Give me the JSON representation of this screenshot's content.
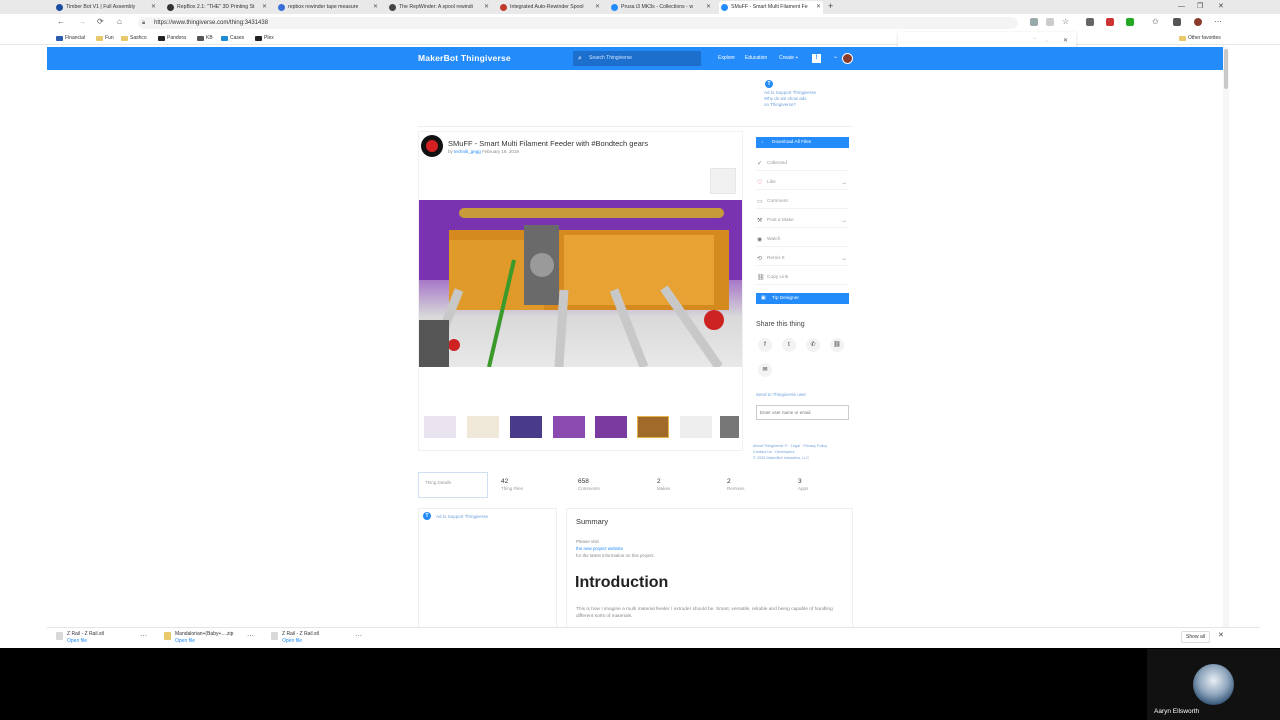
{
  "browser": {
    "tabs": [
      {
        "title": "Timber Bot V1 | Full Assembly",
        "color": "#1a4fa0"
      },
      {
        "title": "RepBox 2.1: \"THE\" 3D Printing St",
        "color": "#333333"
      },
      {
        "title": "repbox rewinder tape measure",
        "color": "#3b6fd8"
      },
      {
        "title": "The RepWinder: A spool rewindi",
        "color": "#444444"
      },
      {
        "title": "Integrated Auto-Rewinder Spool",
        "color": "#c0392b"
      },
      {
        "title": "Prusa i3 MK3s - Collections - w",
        "color": "#248bfb"
      },
      {
        "title": "SMuFF - Smart Multi Filament Fe",
        "color": "#248bfb"
      }
    ],
    "new_tab": "+",
    "url": "https://www.thingiverse.com/thing:3431438",
    "bookmarks": [
      "Financial",
      "Fun",
      "Sashco",
      "Pandora",
      "KB",
      "Cases",
      "Plex"
    ],
    "other_favorites": "Other favorites"
  },
  "site": {
    "logo": "MakerBot Thingiverse",
    "search_placeholder": "Search Thingiverse",
    "nav": [
      "Explore",
      "Education",
      "Create +"
    ],
    "notif": "!"
  },
  "support": {
    "line1": "Ad to Support Thingiverse",
    "line2": "Why do we show ads",
    "line3": "on Thingiverse?"
  },
  "thing": {
    "title": "SMuFF - Smart Multi Filament Feeder with #Bondtech gears",
    "by": "by",
    "author": "technik_gegg",
    "date": "February 16, 2019"
  },
  "actions": {
    "download": "Download All Files",
    "collected": "Collected",
    "like": "Like",
    "comment": "Comment",
    "post_make": "Post a Make",
    "watch": "Watch",
    "remix": "Remix It",
    "copy_link": "Copy Link",
    "tip": "Tip Designer"
  },
  "share": {
    "title": "Share this thing",
    "send_label": "Send to Thingiverse user",
    "send_placeholder": "Enter user name or email"
  },
  "footer": {
    "line1": "About Thingiverse ® · Legal · Privacy Policy",
    "line2": "Contact Us · Developers",
    "line3": "© 2020 MakerBot Industries, LLC"
  },
  "stats": [
    {
      "n": "",
      "label": "Thing Details"
    },
    {
      "n": "42",
      "label": "Thing Files"
    },
    {
      "n": "658",
      "label": "Comments"
    },
    {
      "n": "2",
      "label": "Makes"
    },
    {
      "n": "2",
      "label": "Remixes"
    },
    {
      "n": "3",
      "label": "Apps"
    }
  ],
  "left_support": "Ad to Support Thingiverse",
  "summary": {
    "title": "Summary",
    "please_visit": "Please visit",
    "link": "the new project website",
    "rest": "for the latest information on this project.",
    "intro": "Introduction",
    "intro_text": "This is how I imagine a multi material feeder / extruder should be. Smart, versatile, reliable and being capable of handling different sorts of materials."
  },
  "downloads": [
    {
      "name": "Z Rail - Z Rail.stl",
      "open": "Open file"
    },
    {
      "name": "Mandalorian+(Baby+....zip",
      "open": "Open file"
    },
    {
      "name": "Z Rail - Z Rail.stl",
      "open": "Open file"
    }
  ],
  "show_all": "Show all",
  "webcam_name": "Aaryn Ellsworth"
}
